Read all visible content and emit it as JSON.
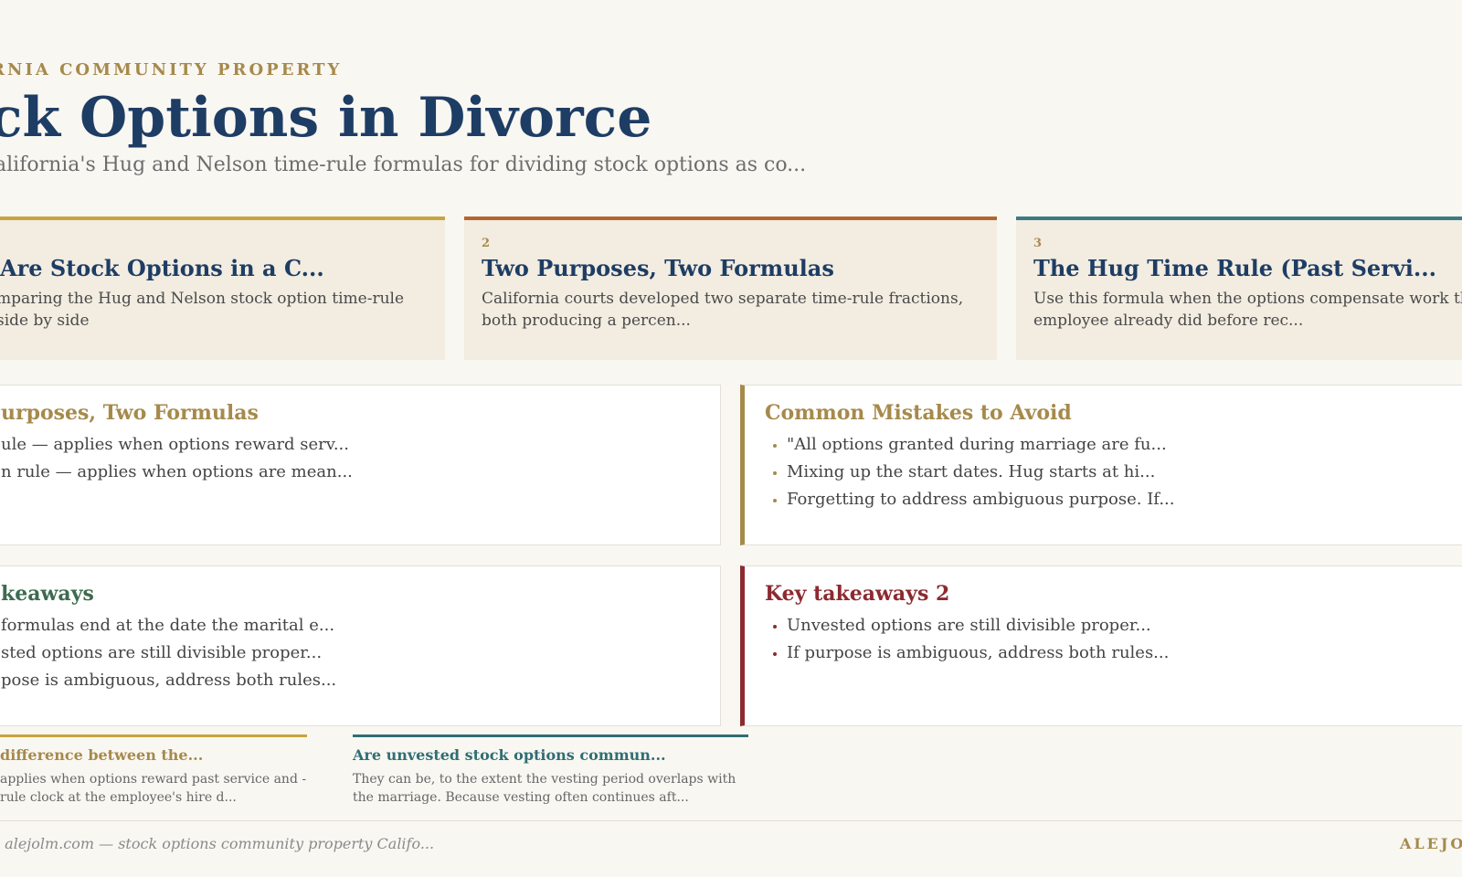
{
  "header": {
    "eyebrow": "RNIA COMMUNITY PROPERTY",
    "title": "ck Options in Divorce",
    "subtitle": "alifornia's Hug and Nelson time-rule formulas for dividing stock options as co..."
  },
  "cards": [
    {
      "number": "",
      "title": "Are Stock Options in a C...",
      "desc": "mparing the Hug and Nelson stock option time-rule side by side",
      "accent": "#c9a43a"
    },
    {
      "number": "2",
      "title": "Two Purposes, Two Formulas",
      "desc": "California courts developed two separate time-rule fractions, both producing a percen...",
      "accent": "#b4652d"
    },
    {
      "number": "3",
      "title": "The Hug Time Rule (Past Servi...",
      "desc": "Use this formula when the options compensate work the employee already did before rec...",
      "accent": "#3b7b82"
    }
  ],
  "panels": {
    "purposes": {
      "title": "urposes, Two Formulas",
      "items": [
        "ule — applies when options reward serv...",
        "n rule — applies when options are mean..."
      ]
    },
    "mistakes": {
      "title": "Common Mistakes to Avoid",
      "items": [
        "\"All options granted during marriage are fu...",
        "Mixing up the start dates. Hug starts at hi...",
        "Forgetting to address ambiguous purpose. If..."
      ]
    },
    "takeaways": {
      "title": "keaways",
      "items": [
        "formulas end at the date the marital e...",
        "sted options are still divisible proper...",
        "pose is ambiguous, address both rules..."
      ]
    },
    "takeaways2": {
      "title": "Key takeaways 2",
      "items": [
        "Unvested options are still divisible proper...",
        "If purpose is ambiguous, address both rules..."
      ]
    }
  },
  "faq": [
    {
      "q": "difference between the...",
      "a": "applies when options reward past service and -rule clock at the employee's hire d..."
    },
    {
      "q": "Are unvested stock options commun...",
      "a": "They can be, to the extent the vesting period overlaps with the marriage. Because vesting often continues aft..."
    }
  ],
  "footer": {
    "text": "· alejolm.com — stock options community property Califo...",
    "brand": "ALEJO"
  },
  "colors": {
    "navy": "#1e3d64",
    "gold": "#a68a4c",
    "green": "#3d6b50",
    "crimson": "#8c2a30",
    "teal": "#2f6e74"
  }
}
